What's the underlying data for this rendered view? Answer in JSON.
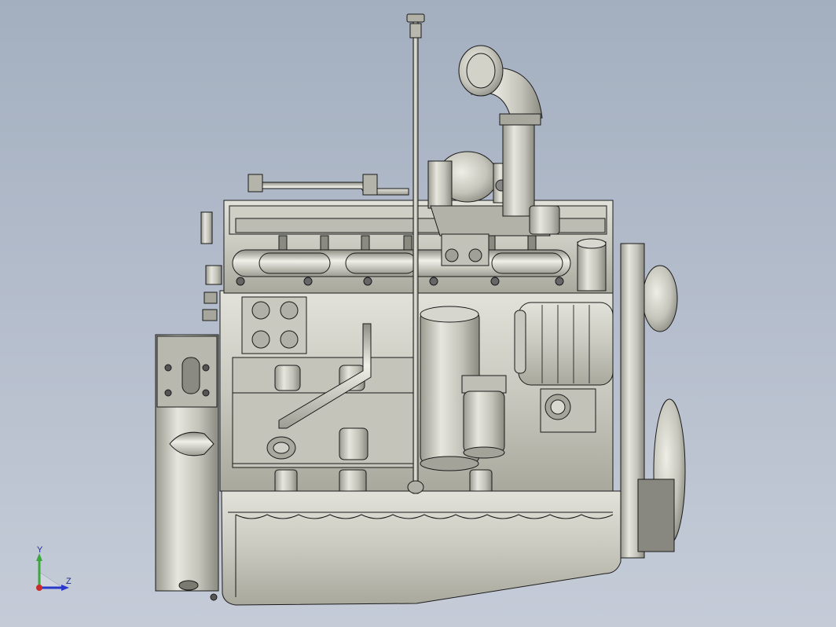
{
  "view": {
    "model_name": "engine-assembly",
    "projection": "side-elevation",
    "background_top": "#a3afbf",
    "background_bottom": "#c5ccd8"
  },
  "triad": {
    "y_label": "Y",
    "z_label": "Z",
    "y_color": "#3ea63e",
    "z_color": "#2a39c9",
    "x_color": "#c92a2a"
  },
  "palette": {
    "metal_light": "#d6d6cd",
    "metal_mid": "#bdbdb2",
    "metal_dark": "#8e8e84",
    "edge": "#1a1a1a"
  }
}
